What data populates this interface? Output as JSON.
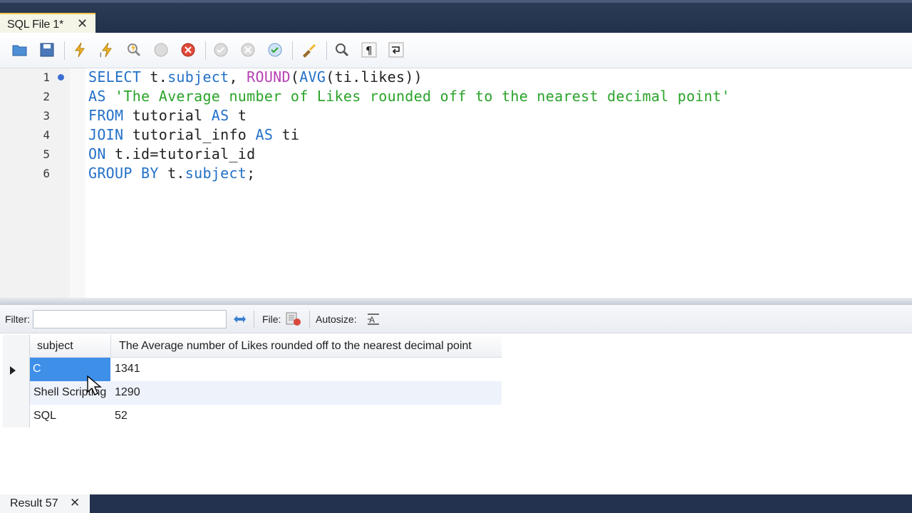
{
  "editor_tab": {
    "label": "SQL File 1*",
    "close": "✕"
  },
  "toolbar": {
    "icons": [
      "open-folder-icon",
      "save-icon",
      "execute-icon",
      "execute-current-icon",
      "explain-icon",
      "stop-icon",
      "toggle-error-icon",
      "commit-icon",
      "rollback-icon",
      "autocommit-icon",
      "beautify-icon",
      "find-icon",
      "invisibles-icon",
      "wrap-icon"
    ]
  },
  "editor": {
    "line_numbers": [
      "1",
      "2",
      "3",
      "4",
      "5",
      "6"
    ],
    "lines": [
      [
        {
          "t": "SELECT",
          "c": "kw"
        },
        {
          "t": " t.",
          "c": ""
        },
        {
          "t": "subject",
          "c": "kw"
        },
        {
          "t": ", ",
          "c": ""
        },
        {
          "t": "ROUND",
          "c": "fn"
        },
        {
          "t": "(",
          "c": ""
        },
        {
          "t": "AVG",
          "c": "kw"
        },
        {
          "t": "(ti.likes))",
          "c": ""
        }
      ],
      [
        {
          "t": "AS",
          "c": "kw"
        },
        {
          "t": " ",
          "c": ""
        },
        {
          "t": "'The Average number of Likes rounded off to the nearest decimal point'",
          "c": "str"
        }
      ],
      [
        {
          "t": "FROM",
          "c": "kw"
        },
        {
          "t": " tutorial ",
          "c": ""
        },
        {
          "t": "AS",
          "c": "kw"
        },
        {
          "t": " t",
          "c": ""
        }
      ],
      [
        {
          "t": "JOIN",
          "c": "kw"
        },
        {
          "t": " tutorial_info ",
          "c": ""
        },
        {
          "t": "AS",
          "c": "kw"
        },
        {
          "t": " ti",
          "c": ""
        }
      ],
      [
        {
          "t": "ON",
          "c": "kw"
        },
        {
          "t": " t.id=tutorial_id",
          "c": ""
        }
      ],
      [
        {
          "t": "GROUP BY",
          "c": "kw"
        },
        {
          "t": " t.",
          "c": ""
        },
        {
          "t": "subject",
          "c": "kw"
        },
        {
          "t": ";",
          "c": ""
        }
      ]
    ]
  },
  "filterbar": {
    "filter_label": "Filter:",
    "filter_value": "",
    "file_label": "File:",
    "autosize_label": "Autosize:"
  },
  "grid": {
    "columns": [
      "subject",
      "The Average number of Likes rounded off to the nearest decimal point"
    ],
    "rows": [
      [
        "C",
        "1341"
      ],
      [
        "Shell Scripting",
        "1290"
      ],
      [
        "SQL",
        "52"
      ]
    ],
    "selected_row": 0
  },
  "result_tab": {
    "label": "Result 57",
    "close": "✕"
  },
  "colors": {
    "keyword": "#2370c8",
    "function": "#b640b2",
    "string": "#2aa32a",
    "selection": "#3d8fe8"
  }
}
